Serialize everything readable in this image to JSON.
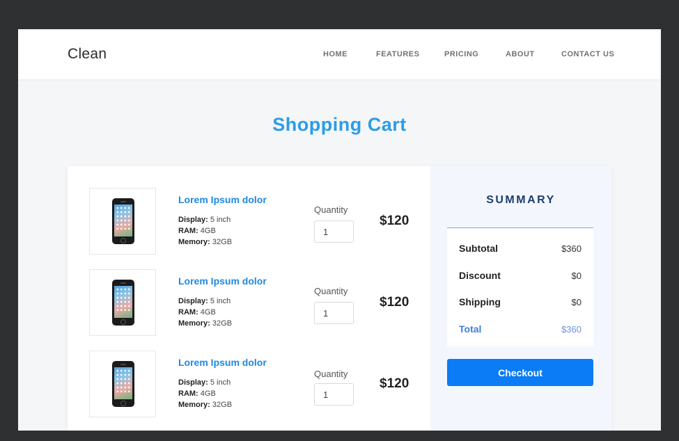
{
  "brand": "Clean",
  "nav": [
    "HOME",
    "FEATURES",
    "PRICING",
    "ABOUT",
    "CONTACT US"
  ],
  "page_title": "Shopping Cart",
  "cart_items": [
    {
      "name": "Lorem Ipsum dolor",
      "display_label": "Display:",
      "display_value": "5 inch",
      "ram_label": "RAM:",
      "ram_value": "4GB",
      "memory_label": "Memory:",
      "memory_value": "32GB",
      "quantity_label": "Quantity",
      "quantity": "1",
      "price": "$120"
    },
    {
      "name": "Lorem Ipsum dolor",
      "display_label": "Display:",
      "display_value": "5 inch",
      "ram_label": "RAM:",
      "ram_value": "4GB",
      "memory_label": "Memory:",
      "memory_value": "32GB",
      "quantity_label": "Quantity",
      "quantity": "1",
      "price": "$120"
    },
    {
      "name": "Lorem Ipsum dolor",
      "display_label": "Display:",
      "display_value": "5 inch",
      "ram_label": "RAM:",
      "ram_value": "4GB",
      "memory_label": "Memory:",
      "memory_value": "32GB",
      "quantity_label": "Quantity",
      "quantity": "1",
      "price": "$120"
    }
  ],
  "summary": {
    "title": "SUMMARY",
    "rows": [
      {
        "label": "Subtotal",
        "value": "$360"
      },
      {
        "label": "Discount",
        "value": "$0"
      },
      {
        "label": "Shipping",
        "value": "$0"
      },
      {
        "label": "Total",
        "value": "$360"
      }
    ],
    "checkout_label": "Checkout"
  },
  "colors": {
    "accent": "#1e88e5",
    "title": "#2b9ce8",
    "checkout": "#0b7cf5",
    "summary_bg": "#f3f7fd",
    "device_frame": "#2f3031"
  },
  "icons": {
    "product_image": "smartphone-image"
  }
}
